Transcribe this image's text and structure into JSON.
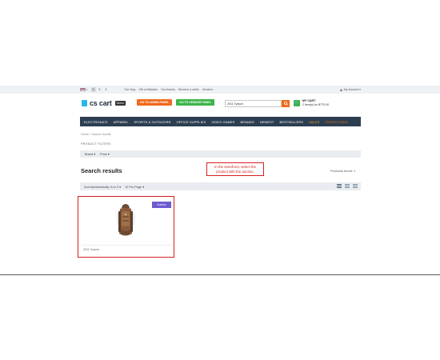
{
  "topbar": {
    "language_caret": "▾",
    "currencies": [
      "$",
      "€",
      "£"
    ],
    "links": [
      "Our blog",
      "Gift certificates",
      "Our brands",
      "Become a seller",
      "Vendors"
    ],
    "account_label": "My Account ▾"
  },
  "header": {
    "logo_text": "cs cart",
    "demo_label": "Demo",
    "admin_button": "GO TO ADMIN PANEL",
    "vendor_button": "GO TO VENDOR PANEL",
    "search_value": "2011 Tysson",
    "cart_title": "MY CART",
    "cart_summary": "2 item(s) for $770.00"
  },
  "nav": {
    "items": [
      "ELECTRONICS",
      "APPAREL",
      "SPORTS & OUTDOORS",
      "OFFICE SUPPLIES",
      "VIDEO GAMES",
      "BRANDS",
      "NEWEST",
      "BESTSELLERS"
    ],
    "sales": "SALES",
    "promotions": "PROMOTIONS"
  },
  "breadcrumb": "Home / Search results",
  "filters": {
    "title": "PRODUCT FILTERS",
    "brand": "Brand ▾",
    "price": "Price ▾"
  },
  "page_title": "Search results",
  "products_found": "Products found: 1",
  "callout": {
    "line1": "In the storefront, select the",
    "line2": "product with the auction."
  },
  "sort": {
    "sort_label": "Sort Alphabetically: A to Z ▾",
    "per_page": "12 Per Page ▾"
  },
  "product": {
    "badge": "Auction",
    "name": "2011 Tysson"
  },
  "colors": {
    "nav_bg": "#2c3e50",
    "accent_orange": "#f06a1c",
    "accent_green": "#3bb54a",
    "highlight_red": "#d41f1f",
    "auction_badge": "#6c5ccf"
  }
}
